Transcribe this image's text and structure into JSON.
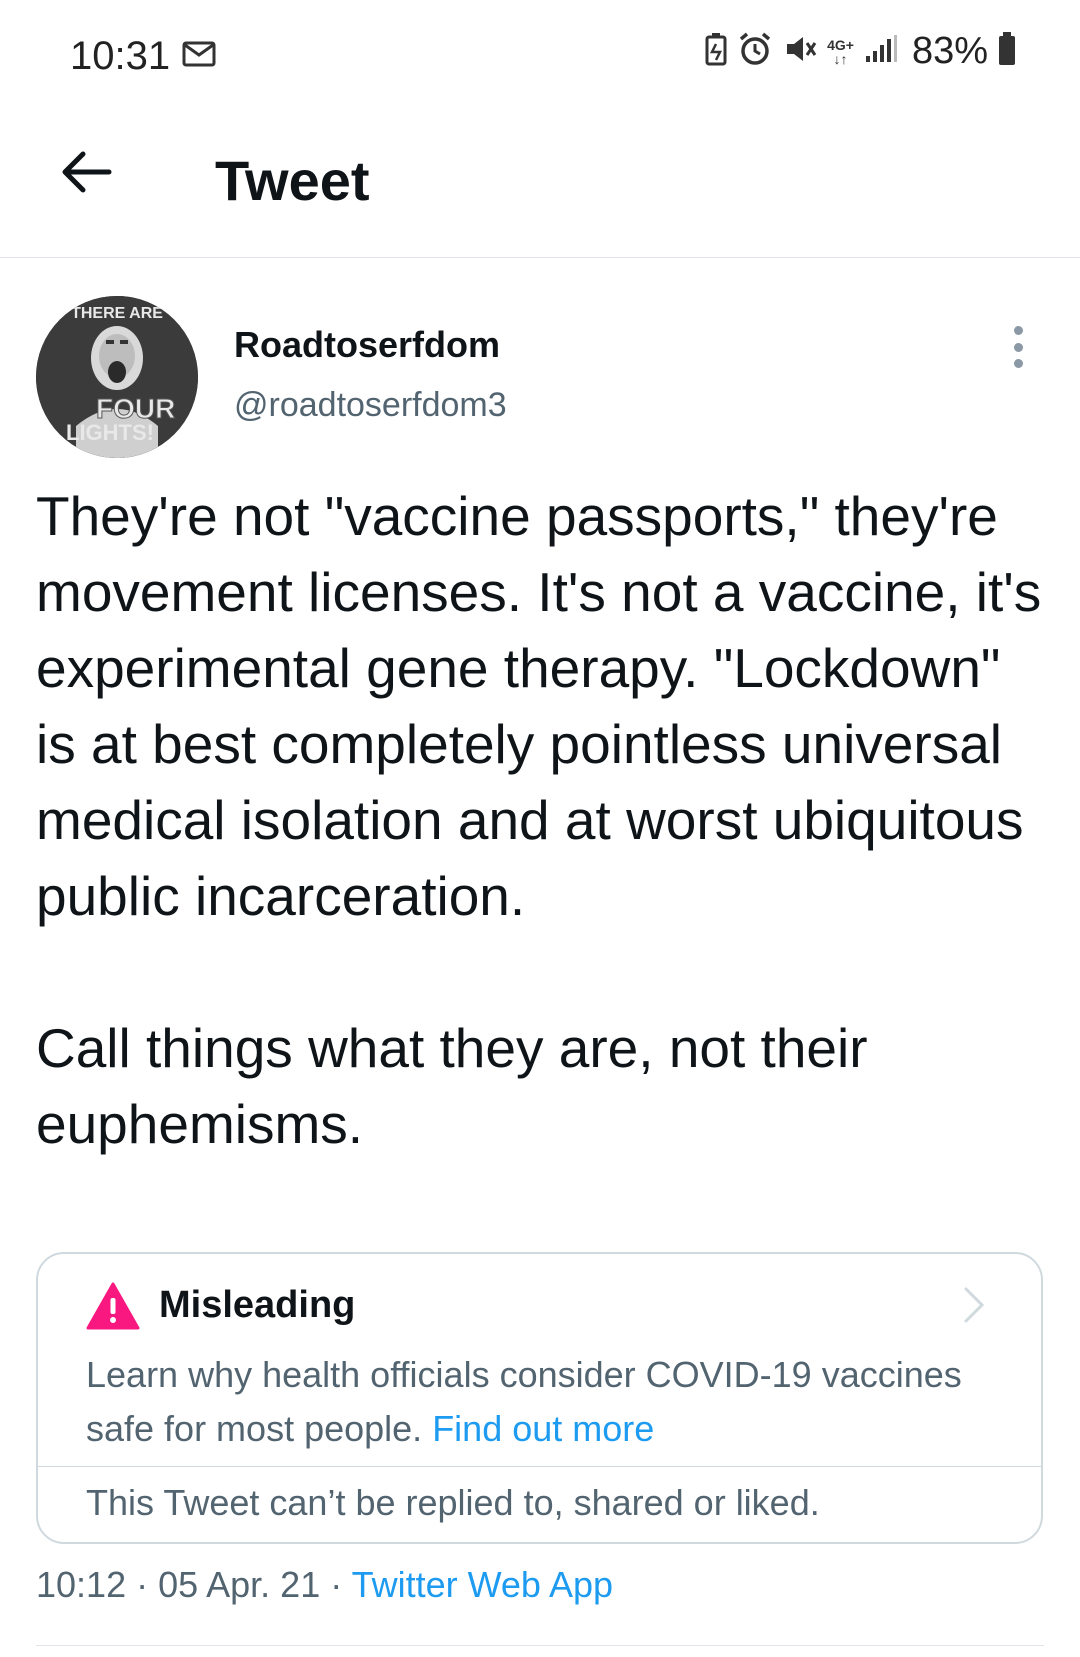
{
  "status_bar": {
    "time": "10:31",
    "network": "4G+",
    "battery_pct": "83%",
    "icons": [
      "mail-icon",
      "battery-saver-icon",
      "alarm-icon",
      "mute-icon",
      "network-icon",
      "signal-icon",
      "battery-icon"
    ]
  },
  "header": {
    "title": "Tweet",
    "back_icon": "arrow-left-icon"
  },
  "tweet": {
    "avatar_text": {
      "top": "THERE ARE",
      "bottom1": "FOUR",
      "bottom2": "LIGHTS!"
    },
    "author_name": "Roadtoserfdom",
    "author_handle": "@roadtoserfdom3",
    "paragraph1": "They're not \"vaccine passports,\" they're movement licenses. It's not a vaccine, it's experimental gene therapy. \"Lockdown\" is at best completely pointless universal medical isolation and at worst ubiquitous public incarceration.",
    "paragraph2": "Call things what they are, not their euphemisms.",
    "timestamp": "10:12 · 05 Apr. 21 · ",
    "source": "Twitter Web App"
  },
  "label_card": {
    "title": "Misleading",
    "body": "Learn why health officials consider COVID-19 vaccines safe for most people. ",
    "link": "Find out more",
    "footer": "This Tweet can’t be replied to, shared or liked.",
    "accent": "#f91880"
  },
  "colors": {
    "text": "#0f1419",
    "muted": "#536471",
    "link": "#1d9bf0",
    "border": "#cfd9de"
  }
}
